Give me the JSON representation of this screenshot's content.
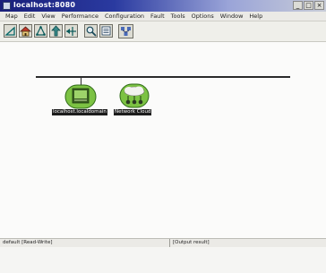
{
  "window": {
    "title": "localhost:8080",
    "buttons": {
      "minimize": "_",
      "maximize": "□",
      "close": "×"
    }
  },
  "menubar": {
    "items": [
      "Map",
      "Edit",
      "View",
      "Performance",
      "Configuration",
      "Fault",
      "Tools",
      "Options",
      "Window",
      "Help"
    ]
  },
  "toolbar": {
    "icons": [
      "triangle-icon",
      "home-icon",
      "network-icon",
      "up-arrow-icon",
      "connect-icon",
      "search-icon",
      "list-icon",
      "nodes-icon"
    ]
  },
  "map": {
    "nodes": [
      {
        "icon": "server-icon",
        "label": "localhost.localdomain"
      },
      {
        "icon": "cloud-network-icon",
        "label": "Network Cloud"
      }
    ]
  },
  "statusbar": {
    "left": "default [Read-Write]",
    "right": "[Output result]"
  },
  "colors": {
    "title_dark": "#1a1f7a",
    "node_green": "#7cc243",
    "canvas": "#fbfbfa"
  }
}
